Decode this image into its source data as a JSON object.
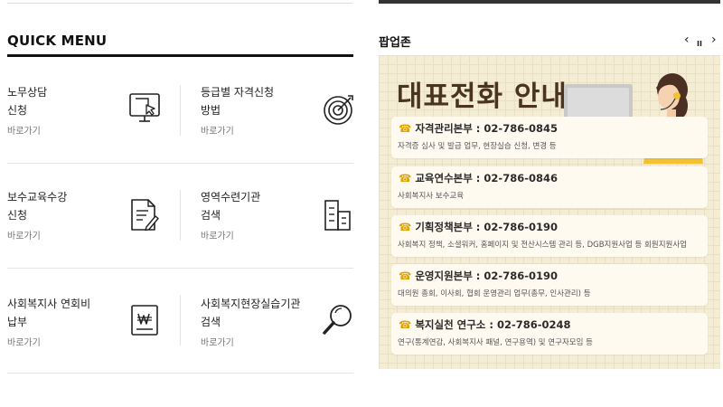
{
  "quick_menu": {
    "title": "QUICK MENU",
    "items": [
      {
        "line1": "노무상담",
        "line2": "신청",
        "link": "바로가기",
        "icon": "monitor-cursor-icon"
      },
      {
        "line1": "등급별 자격신청",
        "line2": "방법",
        "link": "바로가기",
        "icon": "target-arrow-icon"
      },
      {
        "line1": "보수교육수강",
        "line2": "신청",
        "link": "바로가기",
        "icon": "document-pen-icon"
      },
      {
        "line1": "영역수련기관",
        "line2": "검색",
        "link": "바로가기",
        "icon": "building-icon"
      },
      {
        "line1": "사회복지사 연회비",
        "line2": "납부",
        "link": "바로가기",
        "icon": "won-receipt-icon"
      },
      {
        "line1": "사회복지현장실습기관",
        "line2": "검색",
        "link": "바로가기",
        "icon": "magnifier-icon"
      }
    ]
  },
  "popup_zone": {
    "title": "팝업존",
    "controls": {
      "prev": "‹",
      "pause": "II",
      "next": "›"
    },
    "banner": {
      "title": "대표전화 안내",
      "cards": [
        {
          "heading": "자격관리본부 : 02-786-0845",
          "desc": "자격증 심사 및 발급 업무, 현장실습 신청, 변경 등"
        },
        {
          "heading": "교육연수본부 : 02-786-0846",
          "desc": "사회복지사 보수교육"
        },
        {
          "heading": "기획정책본부 : 02-786-0190",
          "desc": "사회복지 정책, 소셜워커, 홈페이지 및 전산시스템 관리 등, DGB지원사업 등 회원지원사업"
        },
        {
          "heading": "운영지원본부 : 02-786-0190",
          "desc": "대의원 총회, 이사회, 협회 운영관리 업무(총무, 인사관리) 등"
        },
        {
          "heading": "복지실천 연구소 : 02-786-0248",
          "desc": "연구(통계연감, 사회복지사 패널, 연구용역) 및 연구자모임 등"
        }
      ],
      "phone_icon": "phone-icon"
    }
  },
  "colors": {
    "accent": "#e0a300",
    "banner_bg": "#f5ecd4",
    "title_brown": "#4a331f"
  }
}
